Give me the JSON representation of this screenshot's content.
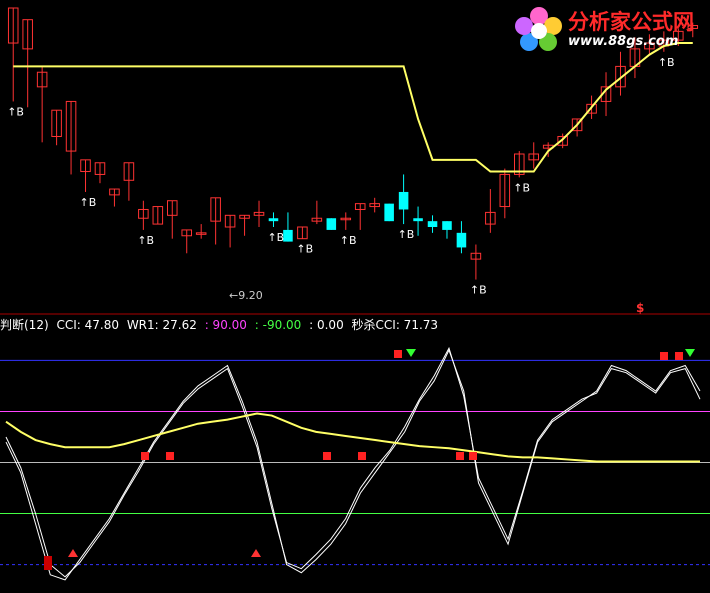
{
  "watermark": {
    "site_name": "分析家公式网",
    "url": "www.88gs.com"
  },
  "indicator_row": [
    {
      "text": "判断(12)",
      "color": "#ffffff"
    },
    {
      "text": "CCI: 47.80",
      "color": "#ffffff"
    },
    {
      "text": "WR1: 27.62",
      "color": "#ffffff"
    },
    {
      "text": ": 90.00",
      "color": "#ff44ff"
    },
    {
      "text": ": -90.00",
      "color": "#44ff44"
    },
    {
      "text": ": 0.00",
      "color": "#ffffff"
    },
    {
      "text": "秒杀CCI: 71.73",
      "color": "#ffffff"
    }
  ],
  "colors": {
    "up": "#ff3333",
    "down": "#00ffff",
    "trail": "#ffff66",
    "ccs": "#ffffff",
    "smooth": "#ffff66"
  },
  "chart_data": [
    {
      "type": "candlestick",
      "title": "",
      "series": [
        {
          "name": "price",
          "ohlc": [
            [
              0.88,
              1.0,
              0.78,
              0.68
            ],
            [
              0.86,
              0.96,
              0.9,
              0.66
            ],
            [
              0.73,
              0.78,
              0.8,
              0.54
            ],
            [
              0.56,
              0.65,
              0.58,
              0.53
            ],
            [
              0.51,
              0.68,
              0.45,
              0.43
            ],
            [
              0.44,
              0.48,
              0.37,
              0.37
            ],
            [
              0.43,
              0.47,
              0.43,
              0.4
            ],
            [
              0.36,
              0.38,
              0.28,
              0.32
            ],
            [
              0.41,
              0.47,
              0.4,
              0.34
            ],
            [
              0.28,
              0.31,
              0.34,
              0.24
            ],
            [
              0.26,
              0.32,
              0.26,
              0.26
            ],
            [
              0.29,
              0.34,
              0.29,
              0.21
            ],
            [
              0.22,
              0.24,
              0.22,
              0.16
            ],
            [
              0.23,
              0.23,
              0.26,
              0.21
            ],
            [
              0.27,
              0.35,
              0.25,
              0.19
            ],
            [
              0.25,
              0.29,
              0.2,
              0.18
            ],
            [
              0.28,
              0.29,
              0.28,
              0.22
            ],
            [
              0.29,
              0.3,
              0.34,
              0.25
            ],
            [
              0.28,
              0.27,
              0.3,
              0.25
            ],
            [
              0.24,
              0.2,
              0.3,
              0.21
            ],
            [
              0.21,
              0.25,
              0.24,
              0.22
            ],
            [
              0.27,
              0.28,
              0.34,
              0.26
            ],
            [
              0.28,
              0.24,
              0.25,
              0.25
            ],
            [
              0.28,
              0.28,
              0.3,
              0.24
            ],
            [
              0.31,
              0.33,
              0.29,
              0.24
            ],
            [
              0.32,
              0.33,
              0.35,
              0.3
            ],
            [
              0.33,
              0.27,
              0.32,
              0.29
            ],
            [
              0.37,
              0.31,
              0.43,
              0.26
            ],
            [
              0.28,
              0.27,
              0.32,
              0.22
            ],
            [
              0.27,
              0.25,
              0.29,
              0.23
            ],
            [
              0.27,
              0.24,
              0.24,
              0.21
            ],
            [
              0.23,
              0.18,
              0.27,
              0.16
            ],
            [
              0.14,
              0.16,
              0.19,
              0.07
            ],
            [
              0.26,
              0.3,
              0.38,
              0.23
            ],
            [
              0.32,
              0.43,
              0.45,
              0.28
            ],
            [
              0.43,
              0.5,
              0.51,
              0.42
            ],
            [
              0.48,
              0.5,
              0.54,
              0.45
            ],
            [
              0.52,
              0.53,
              0.54,
              0.49
            ],
            [
              0.53,
              0.56,
              0.57,
              0.52
            ],
            [
              0.58,
              0.62,
              0.6,
              0.56
            ],
            [
              0.64,
              0.67,
              0.7,
              0.62
            ],
            [
              0.68,
              0.73,
              0.78,
              0.63
            ],
            [
              0.73,
              0.8,
              0.85,
              0.7
            ],
            [
              0.8,
              0.86,
              0.9,
              0.76
            ],
            [
              0.86,
              0.88,
              0.91,
              0.84
            ],
            [
              0.87,
              0.89,
              0.92,
              0.85
            ],
            [
              0.89,
              0.92,
              0.93,
              0.87
            ],
            [
              0.93,
              0.94,
              0.95,
              0.9
            ]
          ]
        }
      ],
      "trail_line": [
        0.8,
        0.8,
        0.8,
        0.8,
        0.8,
        0.8,
        0.8,
        0.8,
        0.8,
        0.8,
        0.8,
        0.8,
        0.8,
        0.8,
        0.8,
        0.8,
        0.8,
        0.8,
        0.8,
        0.8,
        0.8,
        0.8,
        0.8,
        0.8,
        0.8,
        0.8,
        0.8,
        0.8,
        0.62,
        0.48,
        0.48,
        0.48,
        0.48,
        0.44,
        0.44,
        0.44,
        0.44,
        0.51,
        0.55,
        0.6,
        0.66,
        0.72,
        0.76,
        0.8,
        0.84,
        0.87,
        0.88,
        0.88
      ],
      "signal_labels": [
        "↑B",
        "↑B",
        "↑B",
        "↑B",
        "↑B",
        "↑B",
        "↑B",
        "↑B",
        "↑B",
        "↑B"
      ],
      "price_labels": [
        "9.20"
      ],
      "marker_text": "$"
    },
    {
      "type": "line",
      "title": "",
      "ylim": [
        -120,
        120
      ],
      "reference_levels": [
        100,
        50,
        0,
        -50,
        -100
      ],
      "x": [
        0,
        1,
        2,
        3,
        4,
        5,
        6,
        7,
        8,
        9,
        10,
        11,
        12,
        13,
        14,
        15,
        16,
        17,
        18,
        19,
        20,
        21,
        22,
        23,
        24,
        25,
        26,
        27,
        28,
        29,
        30,
        31,
        32,
        33,
        34,
        35,
        36,
        37,
        38,
        39,
        40,
        41,
        42,
        43,
        44,
        45,
        46,
        47
      ],
      "series": [
        {
          "name": "",
          "values": [
            20,
            -10,
            -60,
            -110,
            -115,
            -95,
            -75,
            -55,
            -30,
            -5,
            20,
            40,
            60,
            75,
            85,
            95,
            60,
            20,
            -40,
            -100,
            -108,
            -95,
            -80,
            -60,
            -30,
            -10,
            10,
            30,
            60,
            80,
            110,
            70,
            -20,
            -50,
            -80,
            -30,
            20,
            40,
            50,
            60,
            70,
            95,
            90,
            80,
            70,
            90,
            95,
            70
          ]
        },
        {
          "name": "",
          "values": [
            25,
            -5,
            -50,
            -100,
            -112,
            -98,
            -78,
            -58,
            -32,
            -8,
            18,
            38,
            58,
            72,
            82,
            92,
            55,
            15,
            -45,
            -98,
            -104,
            -90,
            -75,
            -55,
            -25,
            -5,
            12,
            35,
            62,
            85,
            112,
            65,
            -15,
            -45,
            -75,
            -28,
            22,
            42,
            52,
            62,
            68,
            92,
            88,
            78,
            68,
            88,
            92,
            62
          ]
        },
        {
          "name": "",
          "values": [
            40,
            30,
            22,
            18,
            15,
            15,
            15,
            15,
            18,
            22,
            26,
            30,
            34,
            38,
            40,
            42,
            45,
            48,
            46,
            40,
            34,
            30,
            28,
            26,
            24,
            22,
            20,
            18,
            16,
            15,
            14,
            12,
            10,
            8,
            6,
            5,
            5,
            4,
            3,
            2,
            1,
            1,
            1,
            1,
            1,
            1,
            1,
            1
          ]
        }
      ]
    }
  ]
}
